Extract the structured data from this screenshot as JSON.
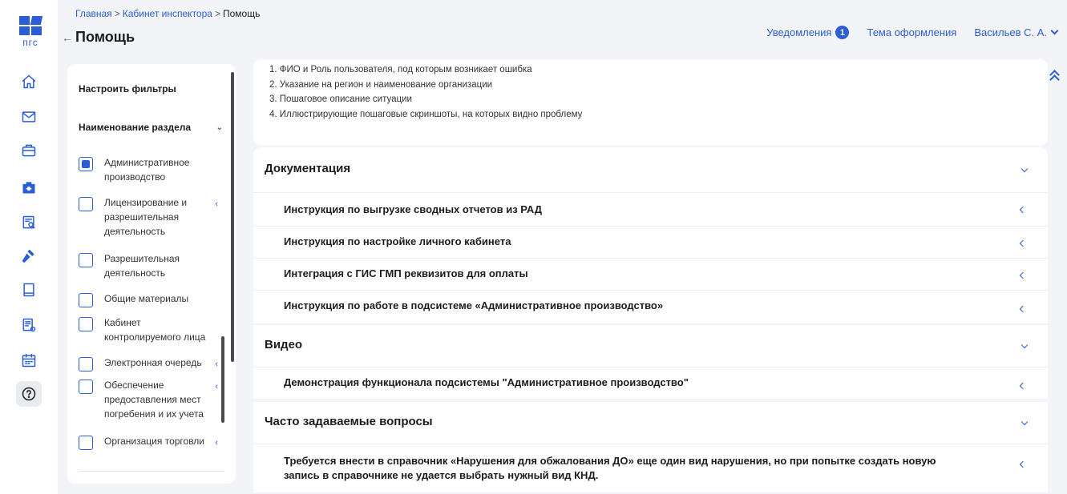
{
  "brand": {
    "logo_text": "пгс",
    "accent": "#2a5dd6"
  },
  "breadcrumb": {
    "home": "Главная",
    "sep": ">",
    "inspector": "Кабинет инспектора",
    "current": "Помощь"
  },
  "header": {
    "back_glyph": "←",
    "title": "Помощь",
    "notifications_label": "Уведомления",
    "notifications_count": "1",
    "theme_label": "Тема оформления",
    "user_label": "Васильев С. А."
  },
  "rail": {
    "icons": [
      "home-icon",
      "mail-icon",
      "briefcase-icon",
      "medkit-icon",
      "document-search-icon",
      "gavel-icon",
      "book-icon",
      "report-icon",
      "calendar-icon",
      "help-icon"
    ],
    "help_glyph": "?"
  },
  "filters": {
    "heading": "Настроить фильтры",
    "section_title": "Наименование раздела",
    "items": [
      {
        "label": "Административное производство",
        "checked": true,
        "has_arrow": false
      },
      {
        "label": "Лицензирование и разрешительная деятельность",
        "checked": false,
        "has_arrow": true
      },
      {
        "label": "Разрешительная деятельность",
        "checked": false,
        "has_arrow": false
      },
      {
        "label": "Общие материалы",
        "checked": false,
        "has_arrow": false
      },
      {
        "label": "Кабинет контролируемого лица",
        "checked": false,
        "has_arrow": false
      },
      {
        "label": "Электронная очередь",
        "checked": false,
        "has_arrow": true
      },
      {
        "label": "Обеспечение предоставления мест погребения и их учета",
        "checked": false,
        "has_arrow": true
      },
      {
        "label": "Организация торговли",
        "checked": false,
        "has_arrow": true
      }
    ],
    "arrow_glyph": "‹",
    "chevron_glyph": "⌄"
  },
  "intro": {
    "lines": [
      "1. ФИО и Роль пользователя, под которым возникает ошибка",
      "2. Указание на регион и наименование организации",
      "3. Пошаговое описание ситуации",
      "4. Иллюстрирующие пошаговые скриншоты, на которых видно проблему"
    ]
  },
  "sections": [
    {
      "title": "Документация",
      "rows": [
        "Инструкция по выгрузке сводных отчетов из РАД",
        "Инструкция по настройке личного кабинета",
        "Интеграция с ГИС ГМП реквизитов для оплаты",
        "Инструкция по работе в подсистеме «Административное производство»"
      ]
    },
    {
      "title": "Видео",
      "rows": [
        "Демонстрация функционала подсистемы \"Административное производство\""
      ]
    },
    {
      "title": "Часто задаваемые вопросы",
      "rows": [
        "Требуется внести в справочник «Нарушения для обжалования ДО» еще один вид нарушения, но при попытке создать новую запись в справочнике не удается выбрать нужный вид КНД."
      ]
    }
  ]
}
